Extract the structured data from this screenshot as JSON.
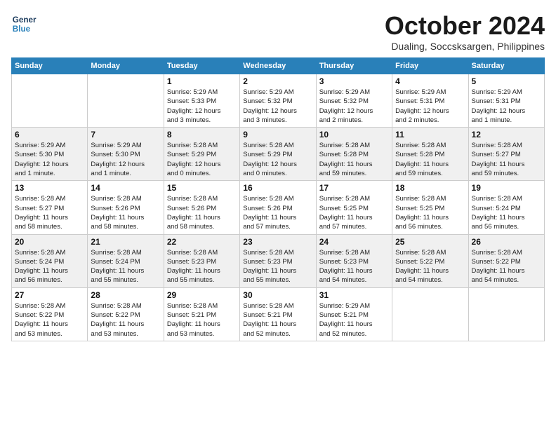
{
  "header": {
    "logo_line1": "General",
    "logo_line2": "Blue",
    "month": "October 2024",
    "location": "Dualing, Soccsksargen, Philippines"
  },
  "days_of_week": [
    "Sunday",
    "Monday",
    "Tuesday",
    "Wednesday",
    "Thursday",
    "Friday",
    "Saturday"
  ],
  "weeks": [
    [
      {
        "day": "",
        "info": ""
      },
      {
        "day": "",
        "info": ""
      },
      {
        "day": "1",
        "info": "Sunrise: 5:29 AM\nSunset: 5:33 PM\nDaylight: 12 hours\nand 3 minutes."
      },
      {
        "day": "2",
        "info": "Sunrise: 5:29 AM\nSunset: 5:32 PM\nDaylight: 12 hours\nand 3 minutes."
      },
      {
        "day": "3",
        "info": "Sunrise: 5:29 AM\nSunset: 5:32 PM\nDaylight: 12 hours\nand 2 minutes."
      },
      {
        "day": "4",
        "info": "Sunrise: 5:29 AM\nSunset: 5:31 PM\nDaylight: 12 hours\nand 2 minutes."
      },
      {
        "day": "5",
        "info": "Sunrise: 5:29 AM\nSunset: 5:31 PM\nDaylight: 12 hours\nand 1 minute."
      }
    ],
    [
      {
        "day": "6",
        "info": "Sunrise: 5:29 AM\nSunset: 5:30 PM\nDaylight: 12 hours\nand 1 minute."
      },
      {
        "day": "7",
        "info": "Sunrise: 5:29 AM\nSunset: 5:30 PM\nDaylight: 12 hours\nand 1 minute."
      },
      {
        "day": "8",
        "info": "Sunrise: 5:28 AM\nSunset: 5:29 PM\nDaylight: 12 hours\nand 0 minutes."
      },
      {
        "day": "9",
        "info": "Sunrise: 5:28 AM\nSunset: 5:29 PM\nDaylight: 12 hours\nand 0 minutes."
      },
      {
        "day": "10",
        "info": "Sunrise: 5:28 AM\nSunset: 5:28 PM\nDaylight: 11 hours\nand 59 minutes."
      },
      {
        "day": "11",
        "info": "Sunrise: 5:28 AM\nSunset: 5:28 PM\nDaylight: 11 hours\nand 59 minutes."
      },
      {
        "day": "12",
        "info": "Sunrise: 5:28 AM\nSunset: 5:27 PM\nDaylight: 11 hours\nand 59 minutes."
      }
    ],
    [
      {
        "day": "13",
        "info": "Sunrise: 5:28 AM\nSunset: 5:27 PM\nDaylight: 11 hours\nand 58 minutes."
      },
      {
        "day": "14",
        "info": "Sunrise: 5:28 AM\nSunset: 5:26 PM\nDaylight: 11 hours\nand 58 minutes."
      },
      {
        "day": "15",
        "info": "Sunrise: 5:28 AM\nSunset: 5:26 PM\nDaylight: 11 hours\nand 58 minutes."
      },
      {
        "day": "16",
        "info": "Sunrise: 5:28 AM\nSunset: 5:26 PM\nDaylight: 11 hours\nand 57 minutes."
      },
      {
        "day": "17",
        "info": "Sunrise: 5:28 AM\nSunset: 5:25 PM\nDaylight: 11 hours\nand 57 minutes."
      },
      {
        "day": "18",
        "info": "Sunrise: 5:28 AM\nSunset: 5:25 PM\nDaylight: 11 hours\nand 56 minutes."
      },
      {
        "day": "19",
        "info": "Sunrise: 5:28 AM\nSunset: 5:24 PM\nDaylight: 11 hours\nand 56 minutes."
      }
    ],
    [
      {
        "day": "20",
        "info": "Sunrise: 5:28 AM\nSunset: 5:24 PM\nDaylight: 11 hours\nand 56 minutes."
      },
      {
        "day": "21",
        "info": "Sunrise: 5:28 AM\nSunset: 5:24 PM\nDaylight: 11 hours\nand 55 minutes."
      },
      {
        "day": "22",
        "info": "Sunrise: 5:28 AM\nSunset: 5:23 PM\nDaylight: 11 hours\nand 55 minutes."
      },
      {
        "day": "23",
        "info": "Sunrise: 5:28 AM\nSunset: 5:23 PM\nDaylight: 11 hours\nand 55 minutes."
      },
      {
        "day": "24",
        "info": "Sunrise: 5:28 AM\nSunset: 5:23 PM\nDaylight: 11 hours\nand 54 minutes."
      },
      {
        "day": "25",
        "info": "Sunrise: 5:28 AM\nSunset: 5:22 PM\nDaylight: 11 hours\nand 54 minutes."
      },
      {
        "day": "26",
        "info": "Sunrise: 5:28 AM\nSunset: 5:22 PM\nDaylight: 11 hours\nand 54 minutes."
      }
    ],
    [
      {
        "day": "27",
        "info": "Sunrise: 5:28 AM\nSunset: 5:22 PM\nDaylight: 11 hours\nand 53 minutes."
      },
      {
        "day": "28",
        "info": "Sunrise: 5:28 AM\nSunset: 5:22 PM\nDaylight: 11 hours\nand 53 minutes."
      },
      {
        "day": "29",
        "info": "Sunrise: 5:28 AM\nSunset: 5:21 PM\nDaylight: 11 hours\nand 53 minutes."
      },
      {
        "day": "30",
        "info": "Sunrise: 5:28 AM\nSunset: 5:21 PM\nDaylight: 11 hours\nand 52 minutes."
      },
      {
        "day": "31",
        "info": "Sunrise: 5:29 AM\nSunset: 5:21 PM\nDaylight: 11 hours\nand 52 minutes."
      },
      {
        "day": "",
        "info": ""
      },
      {
        "day": "",
        "info": ""
      }
    ]
  ]
}
